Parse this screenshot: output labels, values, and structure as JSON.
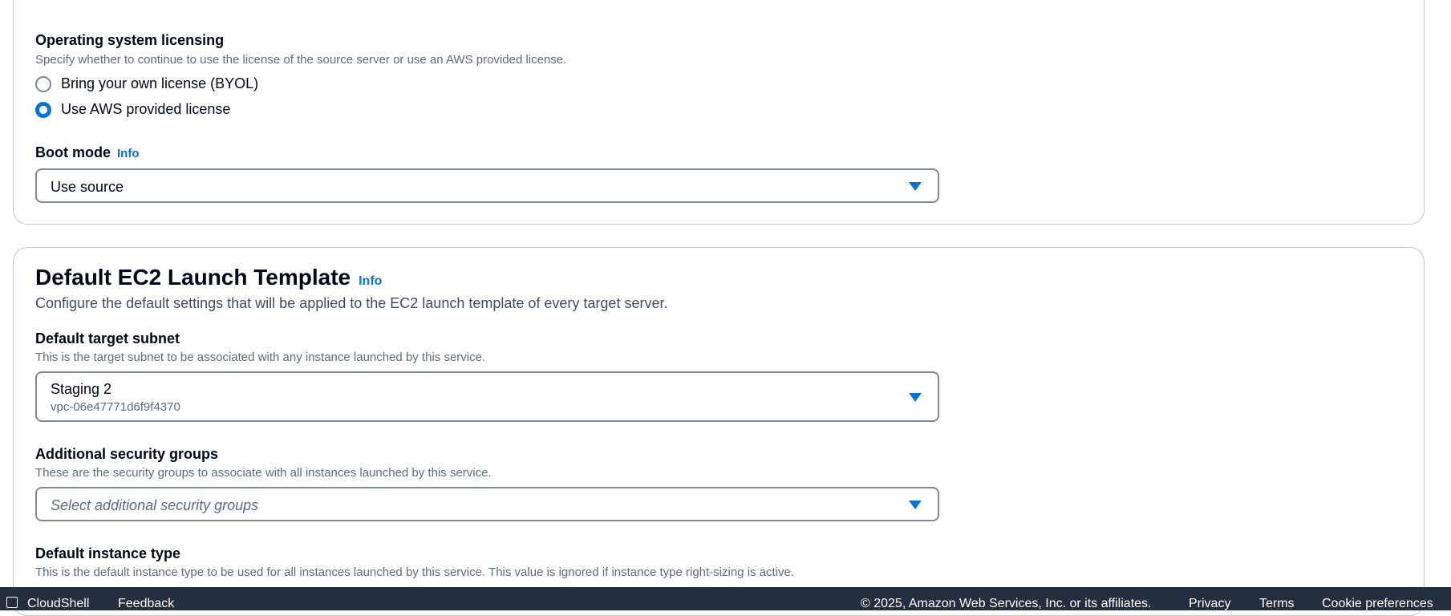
{
  "os_licensing": {
    "label": "Operating system licensing",
    "description": "Specify whether to continue to use the license of the source server or use an AWS provided license.",
    "options": [
      {
        "label": "Bring your own license (BYOL)",
        "selected": false
      },
      {
        "label": "Use AWS provided license",
        "selected": true
      }
    ]
  },
  "boot_mode": {
    "label": "Boot mode",
    "info": "Info",
    "value": "Use source"
  },
  "ec2_template": {
    "title": "Default EC2 Launch Template",
    "info": "Info",
    "description": "Configure the default settings that will be applied to the EC2 launch template of every target server.",
    "subnet": {
      "label": "Default target subnet",
      "description": "This is the target subnet to be associated with any instance launched by this service.",
      "value": "Staging 2",
      "sub_value": "vpc-06e47771d6f9f4370"
    },
    "security_groups": {
      "label": "Additional security groups",
      "description": "These are the security groups to associate with all instances launched by this service.",
      "placeholder": "Select additional security groups"
    },
    "instance_type": {
      "label": "Default instance type",
      "description": "This is the default instance type to be used for all instances launched by this service. This value is ignored if instance type right-sizing is active."
    }
  },
  "footer": {
    "cloudshell": "CloudShell",
    "feedback": "Feedback",
    "copyright": "© 2025, Amazon Web Services, Inc. or its affiliates.",
    "privacy": "Privacy",
    "terms": "Terms",
    "cookie": "Cookie preferences"
  },
  "colors": {
    "accent": "#0972d3",
    "footer_bg": "#232f3e",
    "border": "#7d8998"
  }
}
